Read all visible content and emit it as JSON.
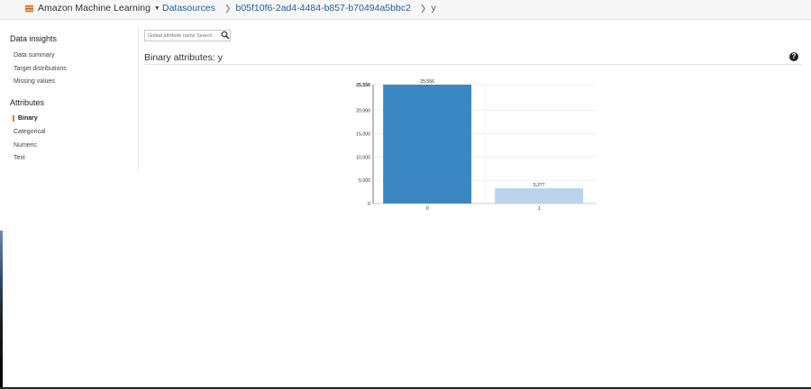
{
  "header": {
    "app_name": "Amazon Machine Learning",
    "breadcrumbs": [
      "Datasources",
      "b05f10f6-2ad4-4484-b857-b70494a5bbc2",
      "y"
    ]
  },
  "sidebar": {
    "sections": [
      {
        "heading": "Data insights",
        "items": [
          {
            "label": "Data summary"
          },
          {
            "label": "Target distributions"
          },
          {
            "label": "Missing values"
          }
        ]
      },
      {
        "heading": "Attributes",
        "items": [
          {
            "label": "Binary",
            "active": true
          },
          {
            "label": "Categorical"
          },
          {
            "label": "Numeric"
          },
          {
            "label": "Text"
          }
        ]
      }
    ]
  },
  "search": {
    "placeholder": "Global attribute name Search"
  },
  "main": {
    "title": "Binary attributes: y",
    "help_icon": "question-circle-icon"
  },
  "colors": {
    "accent": "#e07b24",
    "bar_primary": "#3b87c3",
    "bar_secondary": "#bcd3ee"
  },
  "chart_data": {
    "type": "bar",
    "categories": [
      "0",
      "1"
    ],
    "values": [
      25556,
      3277
    ],
    "data_labels": [
      "25,556",
      "3,277"
    ],
    "ylim": [
      0,
      25556
    ],
    "yticks": [
      0,
      5000,
      10000,
      15000,
      20000,
      25556
    ],
    "ytick_labels": [
      "0",
      "5,000",
      "10,000",
      "15,000",
      "20,000",
      "25,556"
    ],
    "grid": true
  }
}
